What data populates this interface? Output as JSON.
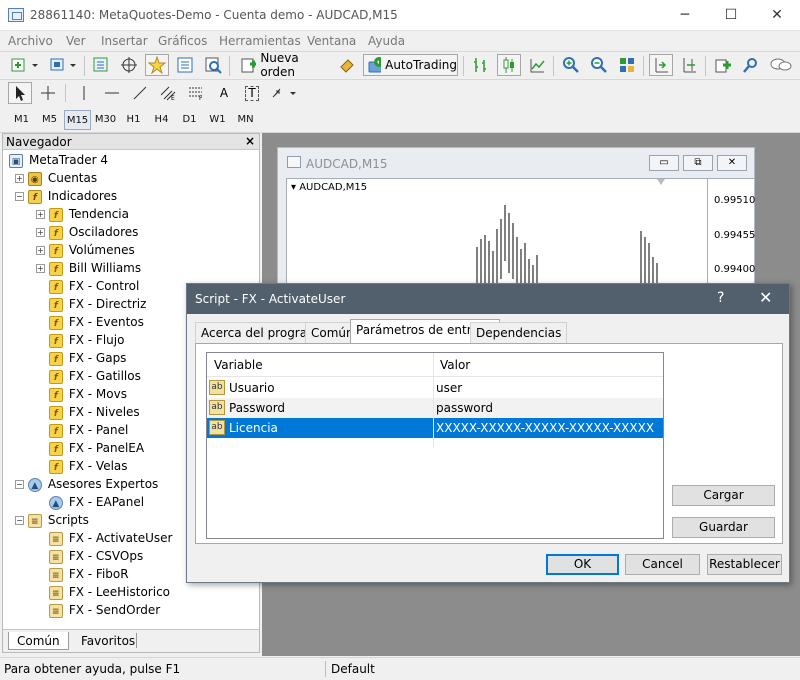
{
  "window": {
    "title": "28861140: MetaQuotes-Demo - Cuenta demo - AUDCAD,M15",
    "minimize_glyph": "─",
    "maximize_glyph": "☐",
    "close_glyph": "✕"
  },
  "menu": [
    "Archivo",
    "Ver",
    "Insertar",
    "Gráficos",
    "Herramientas",
    "Ventana",
    "Ayuda"
  ],
  "toolbar": {
    "new_order": "Nueva orden",
    "autotrading": "AutoTrading",
    "accent_green": "#2e9b32",
    "accent_blue": "#2f6fb6"
  },
  "drawing_tools": {
    "text_tool": "A",
    "label_tool": "T"
  },
  "timeframes": [
    "M1",
    "M5",
    "M15",
    "M30",
    "H1",
    "H4",
    "D1",
    "W1",
    "MN"
  ],
  "active_timeframe": "M15",
  "navigator": {
    "title": "Navegador",
    "close": "×",
    "tabs": [
      "Común",
      "Favoritos"
    ],
    "tree": [
      {
        "label": "MetaTrader 4",
        "icon": "mt4-icon",
        "level": 0,
        "toggle": ""
      },
      {
        "label": "Cuentas",
        "icon": "accounts-icon",
        "level": 1,
        "toggle": "+"
      },
      {
        "label": "Indicadores",
        "icon": "indicators-icon",
        "level": 1,
        "toggle": "−"
      },
      {
        "label": "Tendencia",
        "icon": "function-icon",
        "level": 2,
        "toggle": "+"
      },
      {
        "label": "Osciladores",
        "icon": "function-icon",
        "level": 2,
        "toggle": "+"
      },
      {
        "label": "Volúmenes",
        "icon": "function-icon",
        "level": 2,
        "toggle": "+"
      },
      {
        "label": "Bill Williams",
        "icon": "function-icon",
        "level": 2,
        "toggle": "+"
      },
      {
        "label": "FX - Control",
        "icon": "custom-indicator-icon",
        "level": 2,
        "toggle": ""
      },
      {
        "label": "FX - Directriz",
        "icon": "custom-indicator-icon",
        "level": 2,
        "toggle": ""
      },
      {
        "label": "FX - Eventos",
        "icon": "custom-indicator-icon",
        "level": 2,
        "toggle": ""
      },
      {
        "label": "FX - Flujo",
        "icon": "custom-indicator-icon",
        "level": 2,
        "toggle": ""
      },
      {
        "label": "FX - Gaps",
        "icon": "custom-indicator-icon",
        "level": 2,
        "toggle": ""
      },
      {
        "label": "FX - Gatillos",
        "icon": "custom-indicator-icon",
        "level": 2,
        "toggle": ""
      },
      {
        "label": "FX - Movs",
        "icon": "custom-indicator-icon",
        "level": 2,
        "toggle": ""
      },
      {
        "label": "FX - Niveles",
        "icon": "custom-indicator-icon",
        "level": 2,
        "toggle": ""
      },
      {
        "label": "FX - Panel",
        "icon": "custom-indicator-icon",
        "level": 2,
        "toggle": ""
      },
      {
        "label": "FX - PanelEA",
        "icon": "custom-indicator-icon",
        "level": 2,
        "toggle": ""
      },
      {
        "label": "FX - Velas",
        "icon": "custom-indicator-icon",
        "level": 2,
        "toggle": ""
      },
      {
        "label": "Asesores Expertos",
        "icon": "expert-advisors-icon",
        "level": 1,
        "toggle": "−"
      },
      {
        "label": "FX - EAPanel",
        "icon": "expert-advisor-icon",
        "level": 2,
        "toggle": ""
      },
      {
        "label": "Scripts",
        "icon": "scripts-icon",
        "level": 1,
        "toggle": "−"
      },
      {
        "label": "FX - ActivateUser",
        "icon": "script-icon",
        "level": 2,
        "toggle": ""
      },
      {
        "label": "FX - CSVOps",
        "icon": "script-icon",
        "level": 2,
        "toggle": ""
      },
      {
        "label": "FX - FiboR",
        "icon": "script-icon",
        "level": 2,
        "toggle": ""
      },
      {
        "label": "FX - LeeHistorico",
        "icon": "script-icon",
        "level": 2,
        "toggle": ""
      },
      {
        "label": "FX - SendOrder",
        "icon": "script-icon",
        "level": 2,
        "toggle": ""
      }
    ]
  },
  "chart": {
    "window_title": "AUDCAD,M15",
    "symbol_label": "AUDCAD,M15",
    "prices": [
      "0.99510",
      "0.99455",
      "0.99400"
    ]
  },
  "dialog": {
    "title": "Script - FX - ActivateUser",
    "help": "?",
    "close": "✕",
    "tabs": [
      "Acerca del programa",
      "Común",
      "Parámetros de entrada",
      "Dependencias"
    ],
    "active_tab": "Parámetros de entrada",
    "columns": [
      "Variable",
      "Valor"
    ],
    "rows": [
      {
        "variable": "Usuario",
        "value": "user",
        "type_badge": "ab"
      },
      {
        "variable": "Password",
        "value": "password",
        "type_badge": "ab"
      },
      {
        "variable": "Licencia",
        "value": "XXXXX-XXXXX-XXXXX-XXXXX-XXXXX",
        "type_badge": "ab"
      }
    ],
    "selected_row": 2,
    "buttons": {
      "load": "Cargar",
      "save": "Guardar",
      "ok": "OK",
      "cancel": "Cancel",
      "reset": "Restablecer"
    },
    "selection_color": "#0078d7"
  },
  "status": {
    "help_text": "Para obtener ayuda, pulse F1",
    "profile": "Default"
  }
}
